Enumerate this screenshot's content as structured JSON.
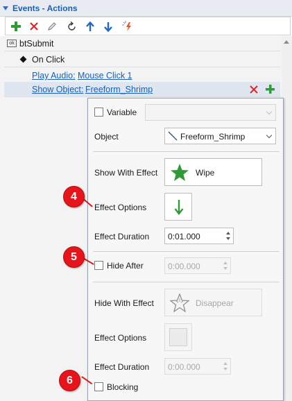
{
  "panel": {
    "title": "Events - Actions"
  },
  "toolbar": {
    "buttons": [
      {
        "name": "add-icon",
        "glyph": "+",
        "color": "#2e9b38"
      },
      {
        "name": "delete-icon",
        "glyph": "✕",
        "color": "#e02424"
      },
      {
        "name": "edit-icon",
        "glyph": "✎",
        "color": "#8a8a8a"
      },
      {
        "name": "reset-icon",
        "glyph": "↻",
        "color": "#333333"
      },
      {
        "name": "move-up-icon",
        "glyph": "↑",
        "color": "#1f67c8"
      },
      {
        "name": "move-down-icon",
        "glyph": "↓",
        "color": "#1f67c8"
      },
      {
        "name": "run-icon",
        "glyph": "⚡",
        "color": "#e05a2a"
      }
    ]
  },
  "tree": {
    "object_badge": "ok",
    "object_name": "btSubmit",
    "event_name": "On Click",
    "action1_label": "Play Audio:",
    "action1_value": "Mouse Click 1",
    "action2_label": "Show Object:",
    "action2_value": "Freeform_Shrimp"
  },
  "properties": {
    "variable_label": "Variable",
    "object_label": "Object",
    "object_value": "Freeform_Shrimp",
    "show_with_effect_label": "Show With Effect",
    "show_effect_value": "Wipe",
    "effect_options_label": "Effect Options",
    "effect_duration_label": "Effect Duration",
    "effect_duration_value": "0:01.000",
    "hide_after_label": "Hide After",
    "hide_after_value": "0:00.000",
    "hide_with_effect_label": "Hide With Effect",
    "hide_effect_value": "Disappear",
    "effect_options2_label": "Effect Options",
    "effect_duration2_label": "Effect Duration",
    "effect_duration2_value": "0:00.000",
    "blocking_label": "Blocking"
  },
  "callouts": {
    "c4": "4",
    "c5": "5",
    "c6": "6"
  },
  "colors": {
    "accent": "#1a5fb4",
    "callout": "#e8141b",
    "green": "#2e9b38"
  }
}
